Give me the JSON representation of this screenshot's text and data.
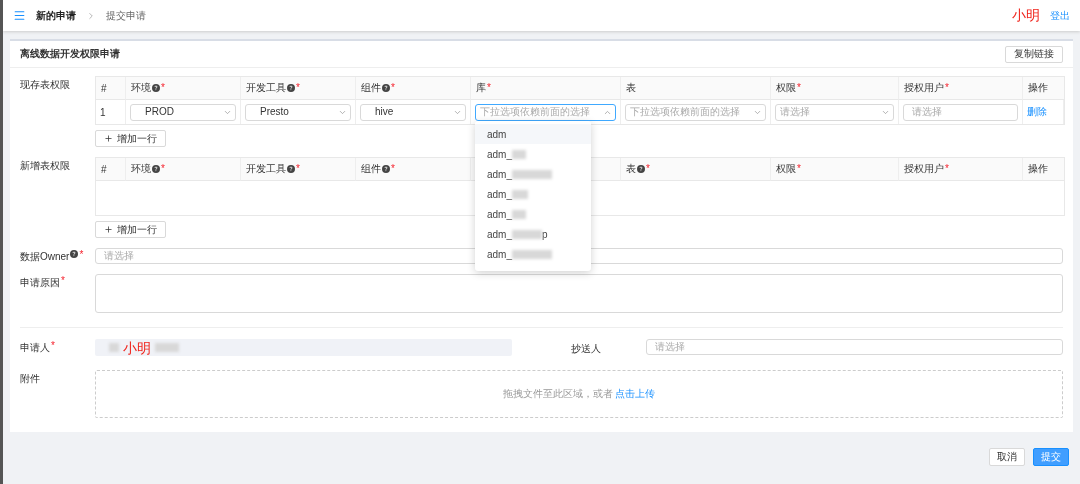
{
  "header": {
    "breadcrumb": [
      {
        "label": "新的申请",
        "current": false
      },
      {
        "label": "提交申请",
        "current": true
      }
    ],
    "user": "小明",
    "logout": "登出"
  },
  "card": {
    "title": "离线数据开发权限申请",
    "copy_button": "复制链接"
  },
  "existing": {
    "label": "现存表权限",
    "columns": [
      {
        "label": "#"
      },
      {
        "label": "环境",
        "help": true,
        "required": "*"
      },
      {
        "label": "开发工具",
        "help": true,
        "required": "*"
      },
      {
        "label": "组件",
        "help": true,
        "required": "*"
      },
      {
        "label": "库",
        "required": "*"
      },
      {
        "label": "表"
      },
      {
        "label": "权限",
        "required": "*"
      },
      {
        "label": "授权用户",
        "required": "*"
      },
      {
        "label": "操作"
      }
    ],
    "rows": [
      {
        "cells": [
          {
            "kind": "text",
            "value": "1"
          },
          {
            "kind": "select",
            "value": "PROD",
            "open": false
          },
          {
            "kind": "select",
            "value": "Presto",
            "open": false
          },
          {
            "kind": "select",
            "value": "hive",
            "open": false
          },
          {
            "kind": "select",
            "placeholder": "下拉选项依赖前面的选择",
            "open": true
          },
          {
            "kind": "select",
            "placeholder": "下拉选项依赖前面的选择",
            "open": false
          },
          {
            "kind": "select",
            "placeholder": "请选择",
            "open": false
          },
          {
            "kind": "input",
            "placeholder": "请选择"
          },
          {
            "kind": "link",
            "value": "删除"
          }
        ]
      }
    ],
    "add_button": "增加一行"
  },
  "dropdown": {
    "options": [
      {
        "label": "adm",
        "hovered": true,
        "redacted": false
      },
      {
        "label": "adm_",
        "hovered": false,
        "redacted": true
      },
      {
        "label": "adm_",
        "hovered": false,
        "redacted": true
      },
      {
        "label": "adm_",
        "hovered": false,
        "redacted": true
      },
      {
        "label": "adm_",
        "hovered": false,
        "redacted": true
      },
      {
        "label": "adm_",
        "hovered": false,
        "redacted": true,
        "suffix": "p"
      },
      {
        "label": "adm_",
        "hovered": false,
        "redacted": true
      }
    ]
  },
  "new_table": {
    "label": "新增表权限",
    "columns": [
      {
        "label": "#"
      },
      {
        "label": "环境",
        "help": true,
        "required": "*"
      },
      {
        "label": "开发工具",
        "help": true,
        "required": "*"
      },
      {
        "label": "组件",
        "help": true,
        "required": "*"
      },
      {},
      {
        "label": "表",
        "help": true,
        "required": "*"
      },
      {
        "label": "权限",
        "required": "*"
      },
      {
        "label": "授权用户",
        "required": "*"
      },
      {
        "label": "操作"
      }
    ],
    "add_button": "增加一行"
  },
  "owner": {
    "label": "数据Owner",
    "help": true,
    "required": "*",
    "placeholder": "请选择"
  },
  "reason": {
    "label": "申请原因",
    "required": "*"
  },
  "applicant": {
    "label": "申请人",
    "required": "*",
    "value": "小明",
    "redacted": true
  },
  "cc": {
    "label": "抄送人",
    "placeholder": "请选择"
  },
  "attachment": {
    "label": "附件",
    "hint": "拖拽文件至此区域，或者",
    "link": "点击上传"
  },
  "footer": {
    "buttons": [
      {
        "label": "取消",
        "kind": "default"
      },
      {
        "label": "提交",
        "kind": "primary"
      }
    ]
  }
}
